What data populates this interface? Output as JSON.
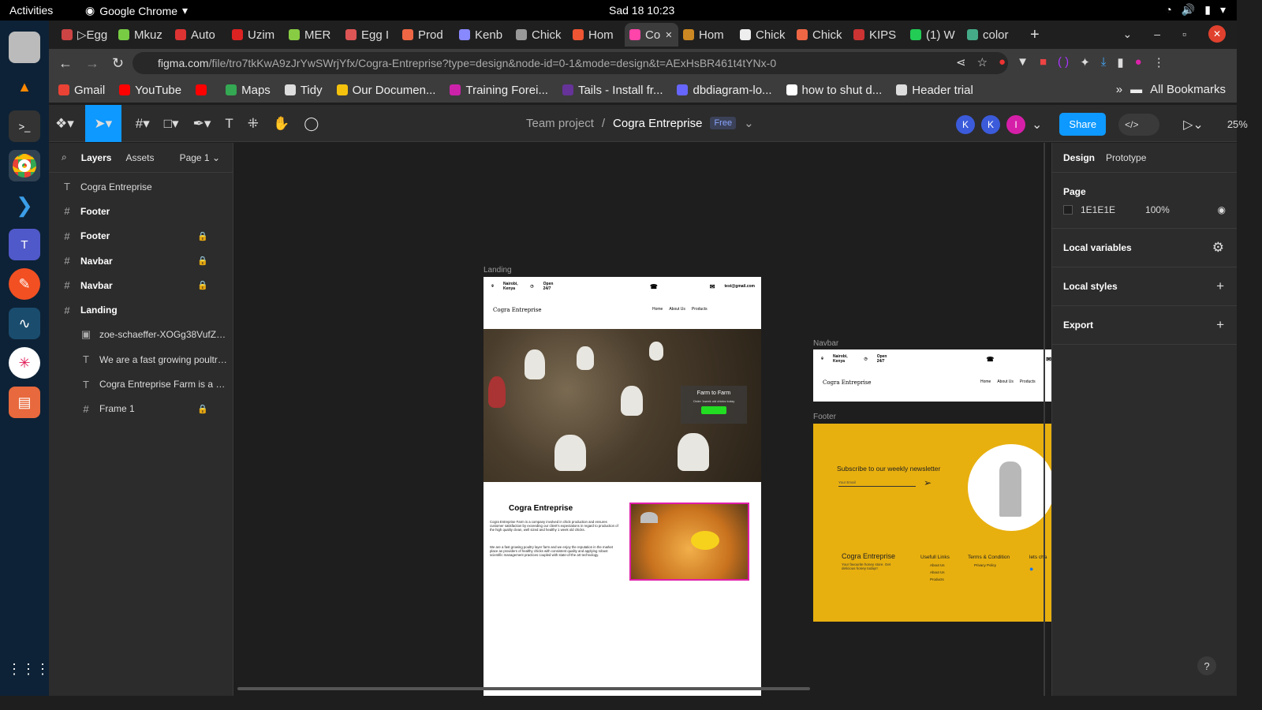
{
  "os": {
    "activities": "Activities",
    "app_name": "Google Chrome",
    "clock": "Sad 18  10:23"
  },
  "browser": {
    "tabs": [
      {
        "label": "▷Egg",
        "color": "#c44"
      },
      {
        "label": "Mkuz",
        "color": "#7c4"
      },
      {
        "label": "Auto",
        "color": "#d33"
      },
      {
        "label": "Uzim",
        "color": "#d22"
      },
      {
        "label": "MER",
        "color": "#8c4"
      },
      {
        "label": "Egg I",
        "color": "#d55"
      },
      {
        "label": "Prod",
        "color": "#e64"
      },
      {
        "label": "Kenb",
        "color": "#88f"
      },
      {
        "label": "Chick",
        "color": "#999"
      },
      {
        "label": "Hom",
        "color": "#e53"
      },
      {
        "label": "Co",
        "color": "#f4a"
      },
      {
        "label": "Hom",
        "color": "#c82"
      },
      {
        "label": "Chick",
        "color": "#eee"
      },
      {
        "label": "Chick",
        "color": "#e64"
      },
      {
        "label": "KIPS",
        "color": "#c33"
      },
      {
        "label": "(1) W",
        "color": "#2c5"
      },
      {
        "label": "color",
        "color": "#4a8"
      }
    ],
    "url_main": "figma.com",
    "url_rest": "/file/tro7tkKwA9zJrYwSWrjYfx/Cogra-Entreprise?type=design&node-id=0-1&mode=design&t=AExHsBR461t4tYNx-0",
    "bookmarks": [
      {
        "label": "Gmail",
        "color": "#ea4335"
      },
      {
        "label": "YouTube",
        "color": "#ff0000"
      },
      {
        "label": "",
        "color": "#ff0000"
      },
      {
        "label": "Maps",
        "color": "#34a853"
      },
      {
        "label": "Tidy",
        "color": "#ddd"
      },
      {
        "label": "Our Documen...",
        "color": "#f4c20d"
      },
      {
        "label": "Training Forei...",
        "color": "#c2a"
      },
      {
        "label": "Tails - Install fr...",
        "color": "#639"
      },
      {
        "label": "dbdiagram-lo...",
        "color": "#66f"
      },
      {
        "label": "how to shut d...",
        "color": "#fff"
      },
      {
        "label": "Header trial",
        "color": "#ddd"
      }
    ],
    "all_bookmarks": "All Bookmarks"
  },
  "figma": {
    "team": "Team project",
    "file": "Cogra Entreprise",
    "plan": "Free",
    "share": "Share",
    "zoom": "25%",
    "avatars": [
      {
        "letter": "K",
        "color": "#3b5bdb"
      },
      {
        "letter": "K",
        "color": "#3b5bdb"
      },
      {
        "letter": "I",
        "color": "#d61fa8"
      }
    ]
  },
  "layers_panel": {
    "tab_layers": "Layers",
    "tab_assets": "Assets",
    "page": "Page 1",
    "items": [
      {
        "name": "Cogra Entreprise",
        "icon": "T",
        "child": false,
        "frame": false,
        "locked": false
      },
      {
        "name": "Footer",
        "icon": "#",
        "child": false,
        "frame": true,
        "locked": false
      },
      {
        "name": "Footer",
        "icon": "#",
        "child": false,
        "frame": true,
        "locked": true
      },
      {
        "name": "Navbar",
        "icon": "#",
        "child": false,
        "frame": true,
        "locked": true
      },
      {
        "name": "Navbar",
        "icon": "#",
        "child": false,
        "frame": true,
        "locked": true
      },
      {
        "name": "Landing",
        "icon": "#",
        "child": false,
        "frame": true,
        "locked": false
      },
      {
        "name": "zoe-schaeffer-XOGg38VufZs-...",
        "icon": "▣",
        "child": true,
        "frame": false,
        "locked": false
      },
      {
        "name": "We are a fast growing poultry ...",
        "icon": "T",
        "child": true,
        "frame": false,
        "locked": false
      },
      {
        "name": "Cogra Entreprise Farm is a co...",
        "icon": "T",
        "child": true,
        "frame": false,
        "locked": false
      },
      {
        "name": "Frame 1",
        "icon": "#",
        "child": true,
        "frame": false,
        "locked": true
      }
    ]
  },
  "canvas": {
    "landing_label": "Landing",
    "navbar_label": "Navbar",
    "footer_label": "Footer",
    "nav_location": "Nairobi, Kenya",
    "nav_open": "Open 24/7",
    "nav_email": "test@gmail.com",
    "nav_brand": "Cogra Entreprise",
    "nav_links": [
      "Home",
      "About Us",
      "Products"
    ],
    "hero_title": "Farm to Farm",
    "hero_sub": "Order 1week old chicks today",
    "about_title": "Cogra Entreprise",
    "about_p1": "Cogra Entreprise Farm is a company involved in chick production and ensures customer satisfaction by exceeding our client's expectations in regard to production of the high quality clean, well sized and healthy 1 week old chicks.",
    "about_p2": "We are a fast growing poultry layer farm and we enjoy the reputation in the market place as providers of healthy chicks with consistent quality and applying robust scientific management practices coupled with state-of-the art technology.",
    "footer_newsletter": "Subscribe to our weekly newsletter",
    "footer_email": "Your Email",
    "footer_brand": "Cogra Entreprise",
    "footer_tagline": "Your favourite  honey store. Get delicious honey today!!",
    "footer_links_title": "Usefull Links",
    "footer_links": [
      "About Us",
      "About Us",
      "Products"
    ],
    "footer_terms_title": "Terms & Condition",
    "footer_terms": [
      "Privacy Policy"
    ],
    "footer_chat": "lets cha"
  },
  "design_panel": {
    "tab_design": "Design",
    "tab_prototype": "Prototype",
    "page_heading": "Page",
    "page_color": "1E1E1E",
    "page_opacity": "100%",
    "local_variables": "Local variables",
    "local_styles": "Local styles",
    "export": "Export"
  }
}
